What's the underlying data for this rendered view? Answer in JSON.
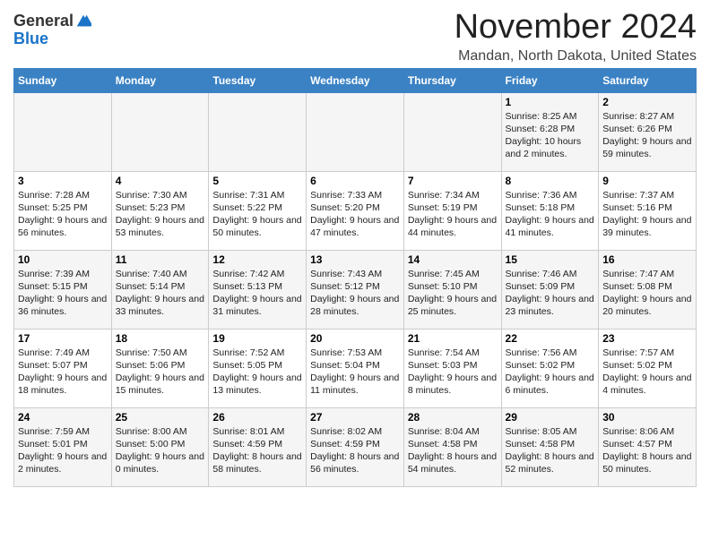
{
  "header": {
    "logo_line1": "General",
    "logo_line2": "Blue",
    "month_title": "November 2024",
    "location": "Mandan, North Dakota, United States"
  },
  "days_of_week": [
    "Sunday",
    "Monday",
    "Tuesday",
    "Wednesday",
    "Thursday",
    "Friday",
    "Saturday"
  ],
  "weeks": [
    [
      {
        "day": "",
        "info": ""
      },
      {
        "day": "",
        "info": ""
      },
      {
        "day": "",
        "info": ""
      },
      {
        "day": "",
        "info": ""
      },
      {
        "day": "",
        "info": ""
      },
      {
        "day": "1",
        "info": "Sunrise: 8:25 AM\nSunset: 6:28 PM\nDaylight: 10 hours and 2 minutes."
      },
      {
        "day": "2",
        "info": "Sunrise: 8:27 AM\nSunset: 6:26 PM\nDaylight: 9 hours and 59 minutes."
      }
    ],
    [
      {
        "day": "3",
        "info": "Sunrise: 7:28 AM\nSunset: 5:25 PM\nDaylight: 9 hours and 56 minutes."
      },
      {
        "day": "4",
        "info": "Sunrise: 7:30 AM\nSunset: 5:23 PM\nDaylight: 9 hours and 53 minutes."
      },
      {
        "day": "5",
        "info": "Sunrise: 7:31 AM\nSunset: 5:22 PM\nDaylight: 9 hours and 50 minutes."
      },
      {
        "day": "6",
        "info": "Sunrise: 7:33 AM\nSunset: 5:20 PM\nDaylight: 9 hours and 47 minutes."
      },
      {
        "day": "7",
        "info": "Sunrise: 7:34 AM\nSunset: 5:19 PM\nDaylight: 9 hours and 44 minutes."
      },
      {
        "day": "8",
        "info": "Sunrise: 7:36 AM\nSunset: 5:18 PM\nDaylight: 9 hours and 41 minutes."
      },
      {
        "day": "9",
        "info": "Sunrise: 7:37 AM\nSunset: 5:16 PM\nDaylight: 9 hours and 39 minutes."
      }
    ],
    [
      {
        "day": "10",
        "info": "Sunrise: 7:39 AM\nSunset: 5:15 PM\nDaylight: 9 hours and 36 minutes."
      },
      {
        "day": "11",
        "info": "Sunrise: 7:40 AM\nSunset: 5:14 PM\nDaylight: 9 hours and 33 minutes."
      },
      {
        "day": "12",
        "info": "Sunrise: 7:42 AM\nSunset: 5:13 PM\nDaylight: 9 hours and 31 minutes."
      },
      {
        "day": "13",
        "info": "Sunrise: 7:43 AM\nSunset: 5:12 PM\nDaylight: 9 hours and 28 minutes."
      },
      {
        "day": "14",
        "info": "Sunrise: 7:45 AM\nSunset: 5:10 PM\nDaylight: 9 hours and 25 minutes."
      },
      {
        "day": "15",
        "info": "Sunrise: 7:46 AM\nSunset: 5:09 PM\nDaylight: 9 hours and 23 minutes."
      },
      {
        "day": "16",
        "info": "Sunrise: 7:47 AM\nSunset: 5:08 PM\nDaylight: 9 hours and 20 minutes."
      }
    ],
    [
      {
        "day": "17",
        "info": "Sunrise: 7:49 AM\nSunset: 5:07 PM\nDaylight: 9 hours and 18 minutes."
      },
      {
        "day": "18",
        "info": "Sunrise: 7:50 AM\nSunset: 5:06 PM\nDaylight: 9 hours and 15 minutes."
      },
      {
        "day": "19",
        "info": "Sunrise: 7:52 AM\nSunset: 5:05 PM\nDaylight: 9 hours and 13 minutes."
      },
      {
        "day": "20",
        "info": "Sunrise: 7:53 AM\nSunset: 5:04 PM\nDaylight: 9 hours and 11 minutes."
      },
      {
        "day": "21",
        "info": "Sunrise: 7:54 AM\nSunset: 5:03 PM\nDaylight: 9 hours and 8 minutes."
      },
      {
        "day": "22",
        "info": "Sunrise: 7:56 AM\nSunset: 5:02 PM\nDaylight: 9 hours and 6 minutes."
      },
      {
        "day": "23",
        "info": "Sunrise: 7:57 AM\nSunset: 5:02 PM\nDaylight: 9 hours and 4 minutes."
      }
    ],
    [
      {
        "day": "24",
        "info": "Sunrise: 7:59 AM\nSunset: 5:01 PM\nDaylight: 9 hours and 2 minutes."
      },
      {
        "day": "25",
        "info": "Sunrise: 8:00 AM\nSunset: 5:00 PM\nDaylight: 9 hours and 0 minutes."
      },
      {
        "day": "26",
        "info": "Sunrise: 8:01 AM\nSunset: 4:59 PM\nDaylight: 8 hours and 58 minutes."
      },
      {
        "day": "27",
        "info": "Sunrise: 8:02 AM\nSunset: 4:59 PM\nDaylight: 8 hours and 56 minutes."
      },
      {
        "day": "28",
        "info": "Sunrise: 8:04 AM\nSunset: 4:58 PM\nDaylight: 8 hours and 54 minutes."
      },
      {
        "day": "29",
        "info": "Sunrise: 8:05 AM\nSunset: 4:58 PM\nDaylight: 8 hours and 52 minutes."
      },
      {
        "day": "30",
        "info": "Sunrise: 8:06 AM\nSunset: 4:57 PM\nDaylight: 8 hours and 50 minutes."
      }
    ]
  ]
}
